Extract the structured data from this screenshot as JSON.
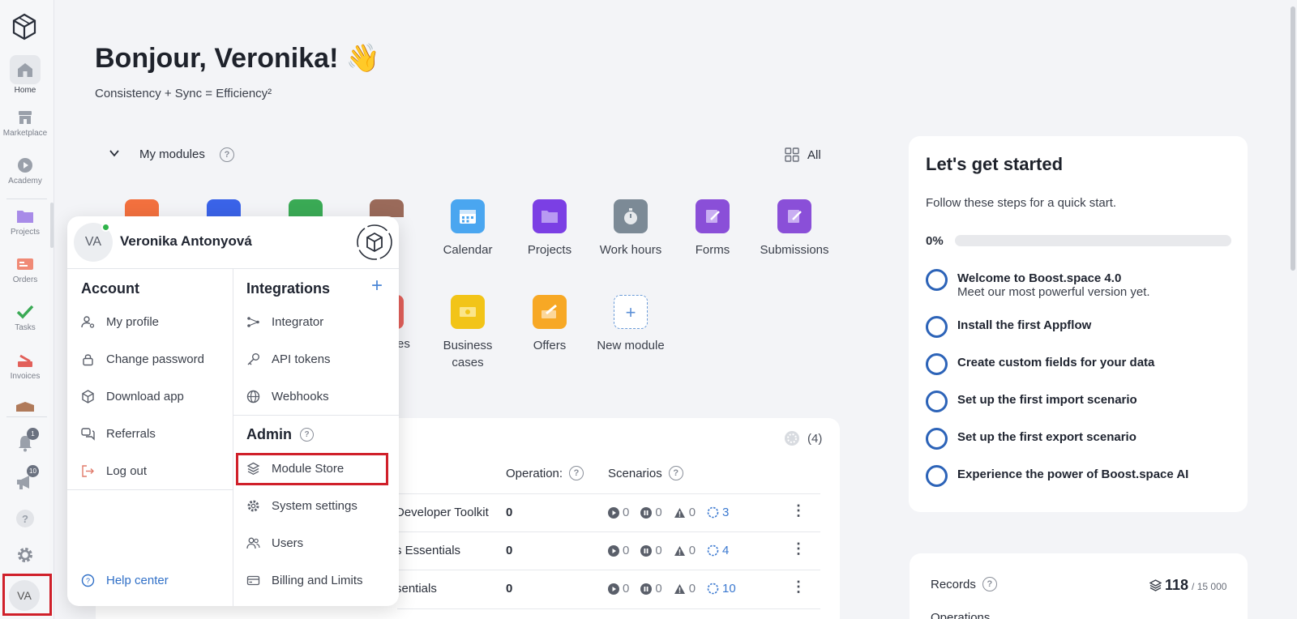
{
  "sidebar": {
    "items": [
      {
        "label": "Home",
        "icon": "home-icon"
      },
      {
        "label": "Marketplace",
        "icon": "store-icon"
      },
      {
        "label": "Academy",
        "icon": "play-icon"
      },
      {
        "label": "Projects",
        "icon": "folder-icon"
      },
      {
        "label": "Orders",
        "icon": "orders-icon"
      },
      {
        "label": "Tasks",
        "icon": "check-icon"
      },
      {
        "label": "Invoices",
        "icon": "invoice-icon"
      }
    ],
    "notifications_badge": "1",
    "announcements_badge": "10",
    "avatar": "VA"
  },
  "header": {
    "greeting": "Bonjour, Veronika!",
    "wave": "👋",
    "tagline": "Consistency + Sync = Efficiency²"
  },
  "modules": {
    "title": "My modules",
    "all_label": "All",
    "visible": [
      {
        "label": "Calendar",
        "color": "#4aa6f0"
      },
      {
        "label": "Projects",
        "color": "#7b3fe4"
      },
      {
        "label": "Work hours",
        "color": "#7c8a96"
      },
      {
        "label": "Forms",
        "color": "#8a4fd8"
      },
      {
        "label": "Submissions",
        "color": "#8a4fd8"
      },
      {
        "label": "Business cases",
        "color": "#f2c418"
      },
      {
        "label": "Offers",
        "color": "#f7a825"
      },
      {
        "label": "New module",
        "color": "#ffffff"
      }
    ],
    "partial": {
      "cts": "cts",
      "es": "es"
    }
  },
  "spaces": {
    "count": "(4)",
    "col_operations": "Operation:",
    "col_scenarios": "Scenarios",
    "rows": [
      {
        "name": "Developer Toolkit",
        "ops": "0",
        "run": "0",
        "pause": "0",
        "warn": "0",
        "total": "3"
      },
      {
        "name": "s Essentials",
        "ops": "0",
        "run": "0",
        "pause": "0",
        "warn": "0",
        "total": "4"
      },
      {
        "name": "sentials",
        "ops": "0",
        "run": "0",
        "pause": "0",
        "warn": "0",
        "total": "10"
      }
    ]
  },
  "start": {
    "title": "Let's get started",
    "subtitle": "Follow these steps for a quick start.",
    "progress_label": "0%",
    "progress": 0,
    "steps": [
      {
        "title": "Welcome to Boost.space 4.0",
        "sub": "Meet our most powerful version yet."
      },
      {
        "title": "Install the first Appflow",
        "sub": ""
      },
      {
        "title": "Create custom fields for your data",
        "sub": ""
      },
      {
        "title": "Set up the first import scenario",
        "sub": ""
      },
      {
        "title": "Set up the first export scenario",
        "sub": ""
      },
      {
        "title": "Experience the power of Boost.space AI",
        "sub": ""
      }
    ]
  },
  "usage": {
    "records_label": "Records",
    "records_value": "118",
    "records_max": "/ 15 000",
    "operations_label": "Operations"
  },
  "popup": {
    "avatar": "VA",
    "name": "Veronika Antonyová",
    "account_title": "Account",
    "account_items": [
      "My profile",
      "Change password",
      "Download app",
      "Referrals",
      "Log out"
    ],
    "help_center": "Help center",
    "integrations_title": "Integrations",
    "integrations_items": [
      "Integrator",
      "API tokens",
      "Webhooks"
    ],
    "admin_title": "Admin",
    "admin_items": [
      "Module Store",
      "System settings",
      "Users",
      "Billing and Limits"
    ]
  }
}
